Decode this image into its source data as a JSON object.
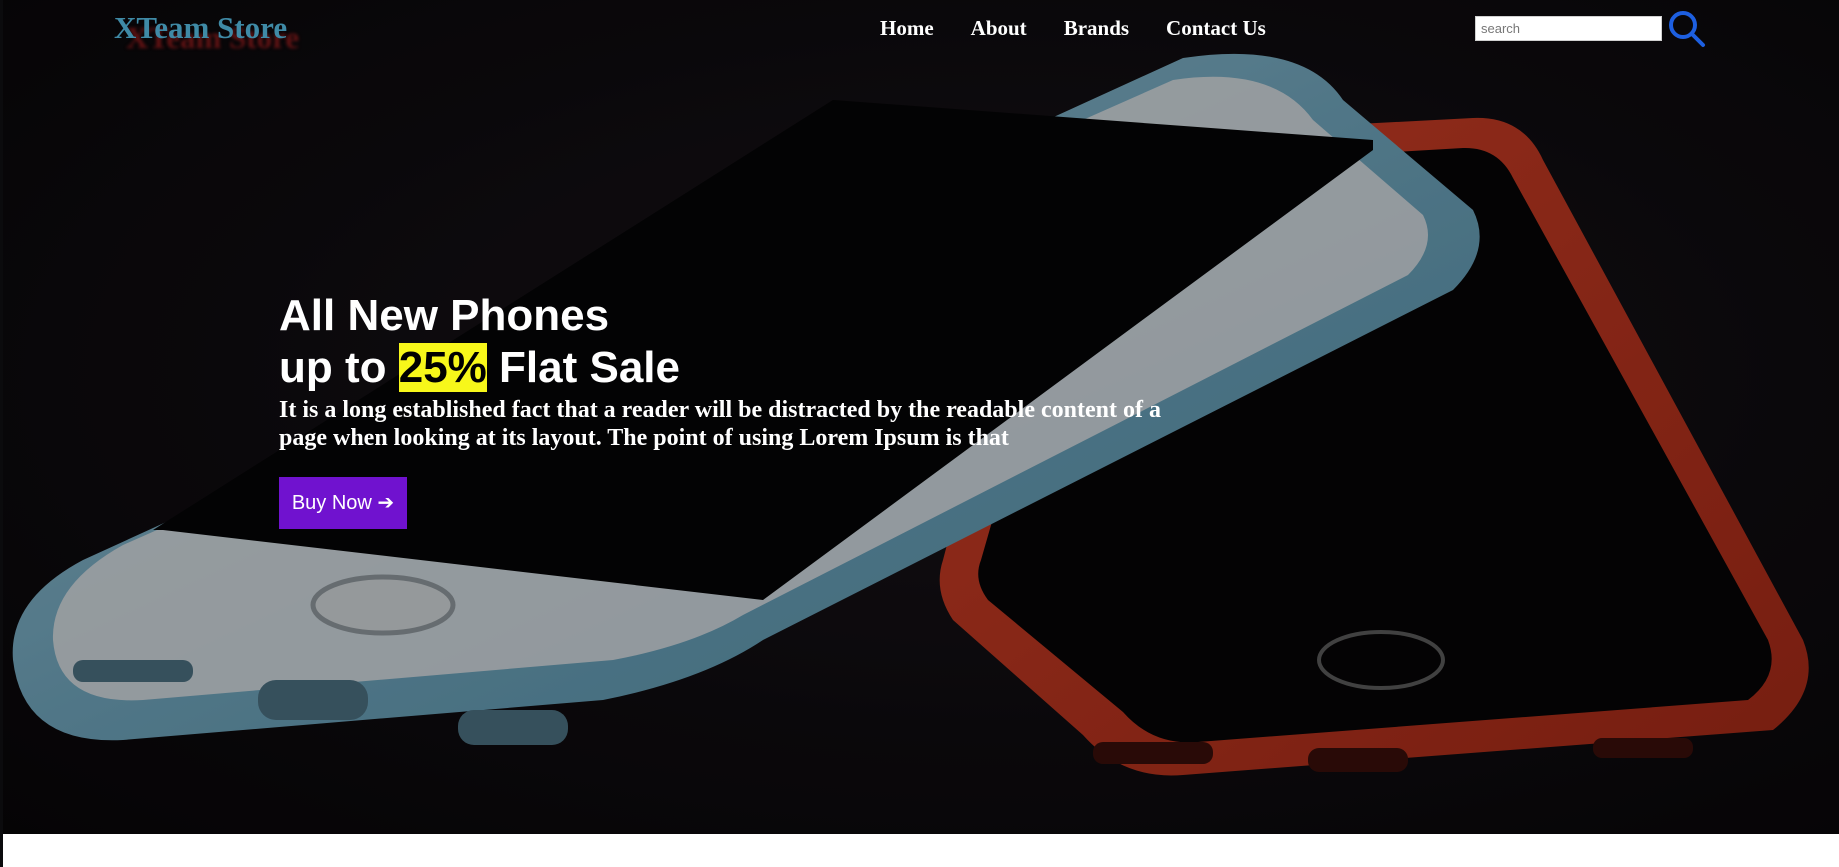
{
  "brand": {
    "name": "XTeam Store"
  },
  "nav": {
    "items": [
      {
        "label": "Home"
      },
      {
        "label": "About"
      },
      {
        "label": "Brands"
      },
      {
        "label": "Contact Us"
      }
    ]
  },
  "search": {
    "placeholder": "search",
    "icon": "search-icon"
  },
  "hero": {
    "headline_line1": "All New Phones",
    "headline_line2_pre": "up to ",
    "headline_highlight": "25%",
    "headline_line2_post": " Flat Sale",
    "description": "It is a long established fact that a reader will be distracted by the readable content of a page when looking at its layout. The point of using Lorem Ipsum is that",
    "cta_label": "Buy Now ➔",
    "background": "two-smartphones-photo"
  },
  "colors": {
    "brand": "#3f8aa6",
    "highlight": "#f7f71a",
    "cta": "#7012cf",
    "search_icon": "#1d5fe0"
  }
}
